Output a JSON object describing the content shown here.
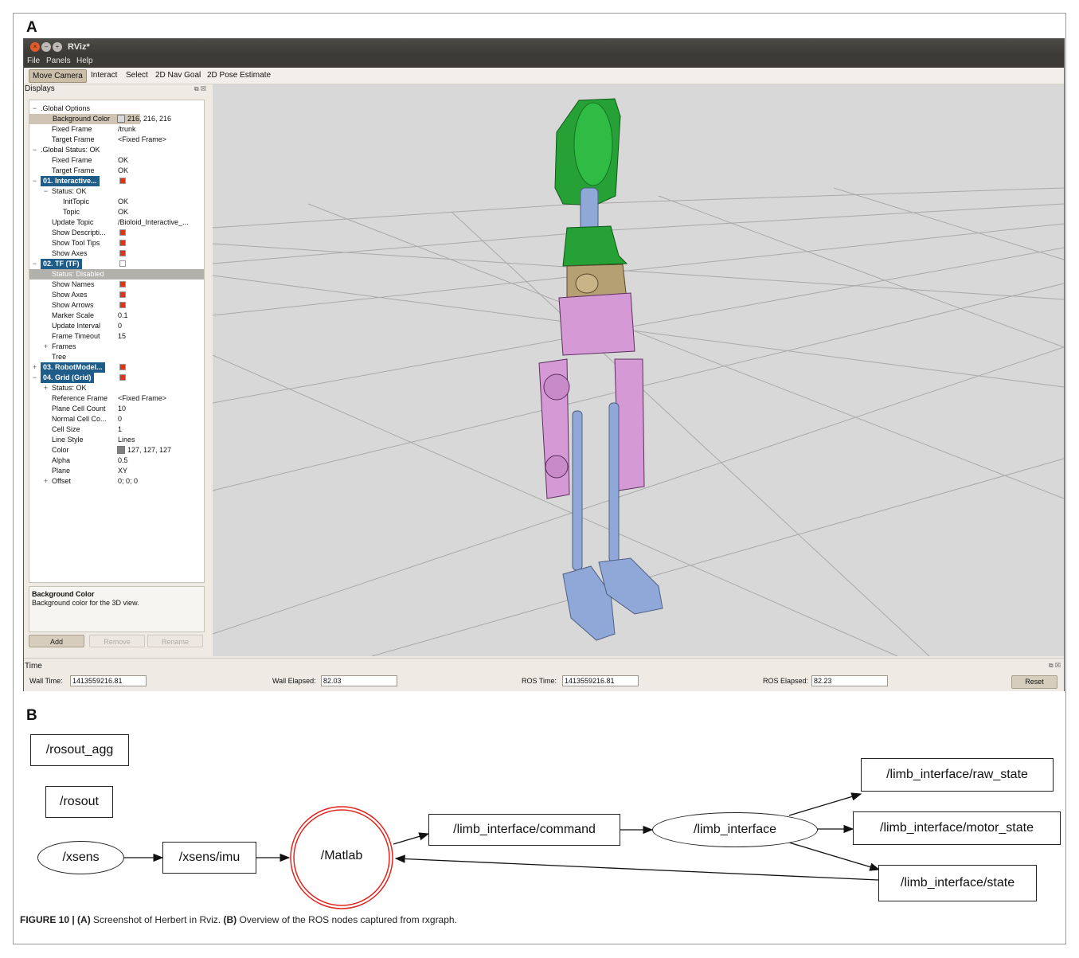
{
  "figure": {
    "label_a": "A",
    "label_b": "B",
    "caption_prefix": "FIGURE 10 | ",
    "caption_a_tag": "(A)",
    "caption_a_text": " Screenshot of Herbert in Rviz. ",
    "caption_b_tag": "(B)",
    "caption_b_text": " Overview of the ROS nodes captured from rxgraph."
  },
  "rviz": {
    "title": "RViz*",
    "window_buttons": [
      "close-icon",
      "minimize-icon",
      "maximize-icon"
    ],
    "menu": [
      "File",
      "Panels",
      "Help"
    ],
    "tools": [
      "Move Camera",
      "Interact",
      "Select",
      "2D Nav Goal",
      "2D Pose Estimate"
    ],
    "active_tool": "Move Camera",
    "displays_title": "Displays",
    "tree": [
      {
        "exp": "−",
        "label": ".Global Options",
        "value": ""
      },
      {
        "label": "Background Color",
        "value": "216, 216, 216",
        "swatch": "#d8d8d8",
        "style": "sel"
      },
      {
        "label": "Fixed Frame",
        "value": "/trunk"
      },
      {
        "label": "Target Frame",
        "value": "<Fixed Frame>"
      },
      {
        "exp": "−",
        "label": ".Global Status: OK",
        "value": ""
      },
      {
        "label": "Fixed Frame",
        "value": "OK"
      },
      {
        "label": "Target Frame",
        "value": "OK"
      },
      {
        "exp": "−",
        "label": "01. Interactive...",
        "check": true,
        "style": "blue"
      },
      {
        "exp": "−",
        "label": "Status: OK",
        "value": ""
      },
      {
        "label": "InitTopic",
        "value": "OK",
        "indent": 2
      },
      {
        "label": "Topic",
        "value": "OK",
        "indent": 2
      },
      {
        "label": "Update Topic",
        "value": "/Bioloid_Interactive_..."
      },
      {
        "label": "Show Descripti...",
        "check": true
      },
      {
        "label": "Show Tool Tips",
        "check": true
      },
      {
        "label": "Show Axes",
        "check": true
      },
      {
        "exp": "−",
        "label": "02. TF (TF)",
        "check": false,
        "style": "gray-head"
      },
      {
        "label": "Status: Disabled",
        "value": "",
        "style": "gray"
      },
      {
        "label": "Show Names",
        "check": true
      },
      {
        "label": "Show Axes",
        "check": true
      },
      {
        "label": "Show Arrows",
        "check": true
      },
      {
        "label": "Marker Scale",
        "value": "0.1"
      },
      {
        "label": "Update Interval",
        "value": "0"
      },
      {
        "label": "Frame Timeout",
        "value": "15"
      },
      {
        "exp": "+",
        "label": "Frames",
        "value": ""
      },
      {
        "label": "Tree",
        "value": ""
      },
      {
        "exp": "+",
        "label": "03. RobotModel...",
        "check": true,
        "style": "blue"
      },
      {
        "exp": "−",
        "label": "04. Grid (Grid)",
        "check": true,
        "style": "blue"
      },
      {
        "exp": "+",
        "label": "Status: OK",
        "value": ""
      },
      {
        "label": "Reference Frame",
        "value": "<Fixed Frame>"
      },
      {
        "label": "Plane Cell Count",
        "value": "10"
      },
      {
        "label": "Normal Cell Co...",
        "value": "0"
      },
      {
        "label": "Cell Size",
        "value": "1"
      },
      {
        "label": "Line Style",
        "value": "Lines"
      },
      {
        "label": "Color",
        "value": "127, 127, 127",
        "swatch": "#7f7f7f"
      },
      {
        "label": "Alpha",
        "value": "0.5"
      },
      {
        "label": "Plane",
        "value": "XY"
      },
      {
        "exp": "+",
        "label": "Offset",
        "value": "0; 0; 0"
      }
    ],
    "description": {
      "title": "Background Color",
      "text": "Background color for the 3D view."
    },
    "buttons": {
      "add": "Add",
      "remove": "Remove",
      "rename": "Rename"
    },
    "time": {
      "title": "Time",
      "wall_time_label": "Wall Time:",
      "wall_time": "1413559216.81",
      "wall_elapsed_label": "Wall Elapsed:",
      "wall_elapsed": "82.03",
      "ros_time_label": "ROS Time:",
      "ros_time": "1413559216.81",
      "ros_elapsed_label": "ROS Elapsed:",
      "ros_elapsed": "82.23",
      "reset": "Reset"
    },
    "colors": {
      "background": "#d8d8d8",
      "grid": "#7f7f7f",
      "head": "#25a135",
      "hips": "#d59ad6",
      "legs": "#8fa8d8"
    }
  },
  "rxgraph": {
    "nodes": {
      "rosout_agg": "/rosout_agg",
      "rosout": "/rosout",
      "xsens": "/xsens",
      "xsens_imu": "/xsens/imu",
      "matlab": "/Matlab",
      "command": "/limb_interface/command",
      "limb_interface": "/limb_interface",
      "raw_state": "/limb_interface/raw_state",
      "motor_state": "/limb_interface/motor_state",
      "state": "/limb_interface/state"
    },
    "matlab_color": "#e0261f"
  }
}
